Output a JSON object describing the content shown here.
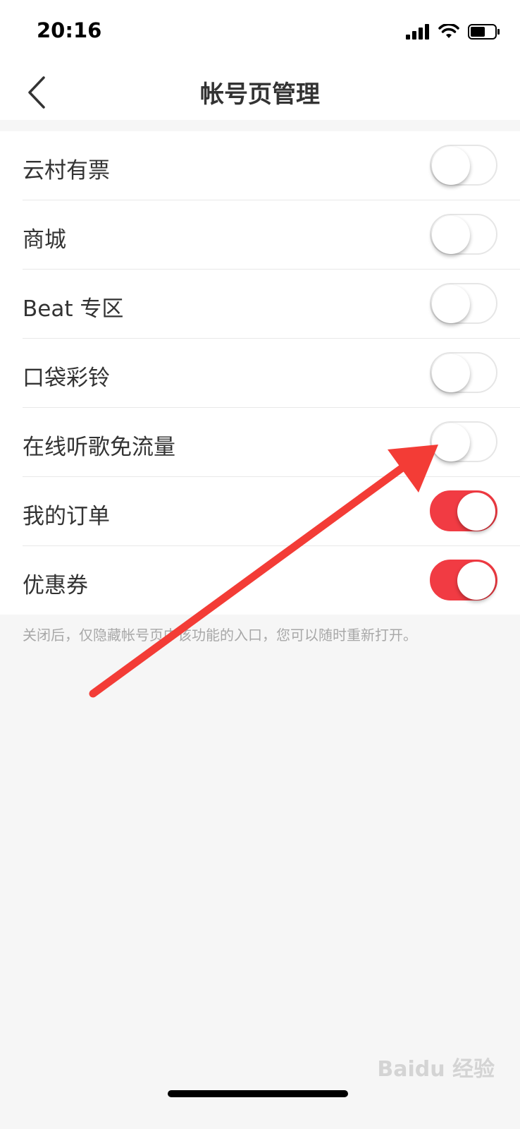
{
  "status": {
    "time": "20:16"
  },
  "header": {
    "title": "帐号页管理"
  },
  "settings": [
    {
      "label": "云村有票",
      "enabled": false
    },
    {
      "label": "商城",
      "enabled": false
    },
    {
      "label": "Beat 专区",
      "enabled": false
    },
    {
      "label": "口袋彩铃",
      "enabled": false
    },
    {
      "label": "在线听歌免流量",
      "enabled": false
    },
    {
      "label": "我的订单",
      "enabled": true
    },
    {
      "label": "优惠券",
      "enabled": true
    }
  ],
  "hint": "关闭后，仅隐藏帐号页中该功能的入口，您可以随时重新打开。",
  "watermark": "Baidu 经验",
  "colors": {
    "accent": "#f13b43",
    "annotation": "#f33c36"
  }
}
